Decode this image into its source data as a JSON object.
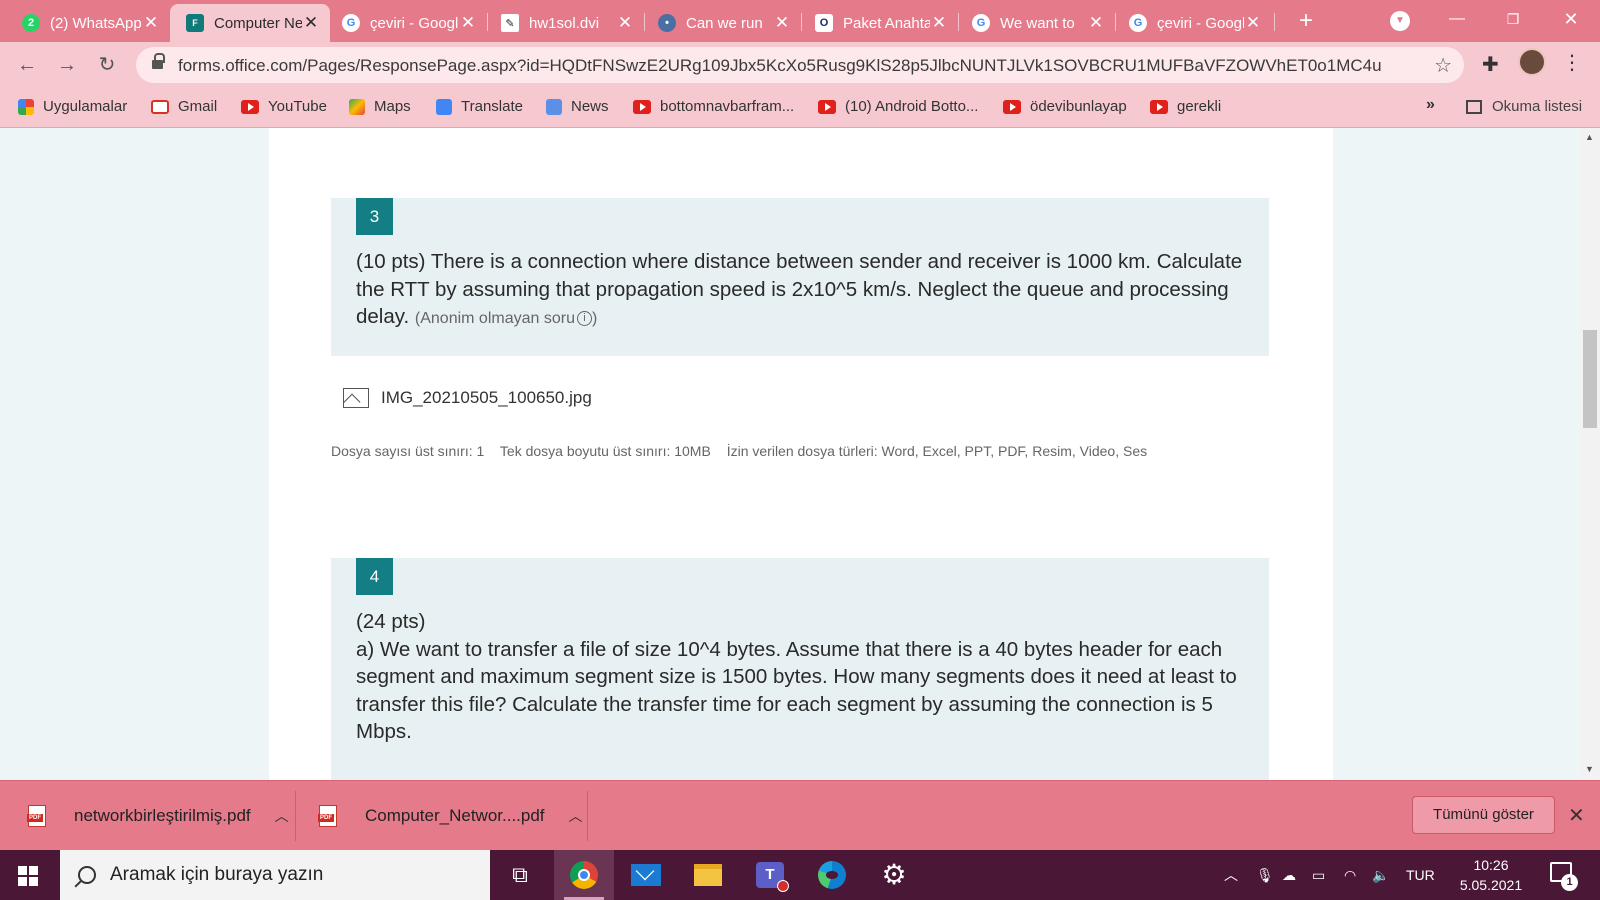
{
  "browser": {
    "tabs": [
      {
        "title": "(2) WhatsApp",
        "icon": "whatsapp-icon",
        "badge": "2"
      },
      {
        "title": "Computer Networks",
        "icon": "forms-icon",
        "active": true
      },
      {
        "title": "çeviri - Google",
        "icon": "google-icon"
      },
      {
        "title": "hw1sol.dvi",
        "icon": "document-icon"
      },
      {
        "title": "Can we run",
        "icon": "tab-page-icon"
      },
      {
        "title": "Paket Anahtarlama",
        "icon": "opera-icon"
      },
      {
        "title": "We want to",
        "icon": "google-icon"
      },
      {
        "title": "çeviri - Google",
        "icon": "google-icon"
      }
    ],
    "new_tab": "+",
    "url": "forms.office.com/Pages/ResponsePage.aspx?id=HQDtFNSwzE2URg109Jbx5KcXo5Rusg9KlS28p5JlbcNUNTJLVk1SOVBCRU1MUFBaVFZOWVhET0o1MC4u",
    "bookmarks": [
      {
        "label": "Uygulamalar",
        "icon": "apps-grid-icon"
      },
      {
        "label": "Gmail",
        "icon": "gmail-icon"
      },
      {
        "label": "YouTube",
        "icon": "youtube-icon"
      },
      {
        "label": "Maps",
        "icon": "maps-icon"
      },
      {
        "label": "Translate",
        "icon": "translate-icon"
      },
      {
        "label": "News",
        "icon": "news-icon"
      },
      {
        "label": "bottomnavbarfram...",
        "icon": "youtube-icon"
      },
      {
        "label": "(10) Android Botto...",
        "icon": "youtube-icon"
      },
      {
        "label": "ödevibunlayap",
        "icon": "youtube-icon"
      },
      {
        "label": "gerekli",
        "icon": "youtube-icon"
      }
    ],
    "bookmarks_more": "»",
    "reading_list": "Okuma listesi"
  },
  "form": {
    "q3": {
      "number": "3",
      "text": "(10 pts) There is a connection where distance between sender and receiver is 1000 km. Calculate the RTT by assuming that propagation speed is 2x10^5 km/s. Neglect the queue and processing delay.",
      "note": "(Anonim olmayan soru",
      "note_close": ")",
      "attachment": "IMG_20210505_100650.jpg",
      "limits": {
        "file_count": "Dosya sayısı üst sınırı: 1",
        "file_size": "Tek dosya boyutu üst sınırı: 10MB",
        "file_types": "İzin verilen dosya türleri: Word, Excel, PPT, PDF, Resim, Video, Ses"
      }
    },
    "q4": {
      "number": "4",
      "line1": "(24 pts)",
      "text": "a) We want to transfer a file of size 10^4 bytes. Assume that there is a 40 bytes header for each segment and maximum segment size is 1500 bytes. How many segments does it need at least to transfer this file? Calculate the transfer time for each segment by assuming the connection is 5 Mbps."
    }
  },
  "downloads": {
    "items": [
      {
        "name": "networkbirleştirilmiş.pdf"
      },
      {
        "name": "Computer_Networ....pdf"
      }
    ],
    "show_all": "Tümünü göster"
  },
  "taskbar": {
    "search_placeholder": "Aramak için buraya yazın",
    "language": "TUR",
    "time": "10:26",
    "date": "5.05.2021",
    "notification_count": "1"
  },
  "colors": {
    "theme_pink": "#e57a8b",
    "tab_active": "#f6c9d0",
    "accent_teal": "#137f84",
    "taskbar": "#4b1736"
  }
}
